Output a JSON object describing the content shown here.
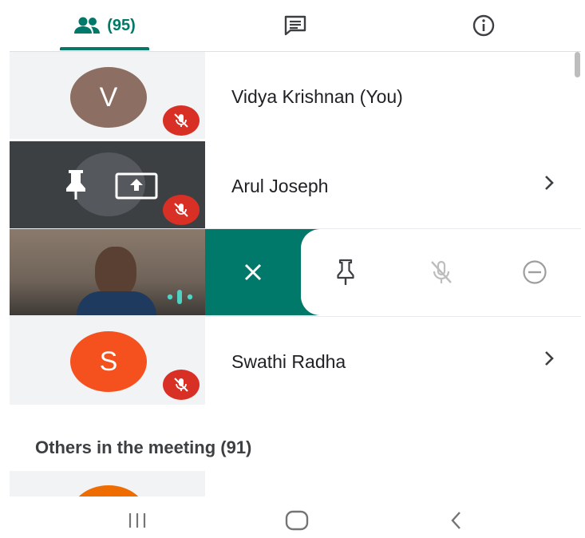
{
  "tabs": {
    "people_count": "(95)",
    "colors": {
      "accent": "#00796b",
      "mute": "#d93025"
    }
  },
  "participants": [
    {
      "name": "Vidya Krishnan (You)",
      "initial": "V",
      "avatar_color": "#8d6e63"
    },
    {
      "name": "Arul Joseph"
    },
    {
      "name": "Swathi Radha",
      "initial": "S",
      "avatar_color": "#f4511e"
    }
  ],
  "actions": {
    "icons": [
      "close-icon",
      "pin-icon",
      "mic-off-icon",
      "remove-icon"
    ]
  },
  "others_heading": "Others in the meeting (91)",
  "nav": {
    "icons": [
      "recents-icon",
      "home-icon",
      "back-icon"
    ]
  }
}
